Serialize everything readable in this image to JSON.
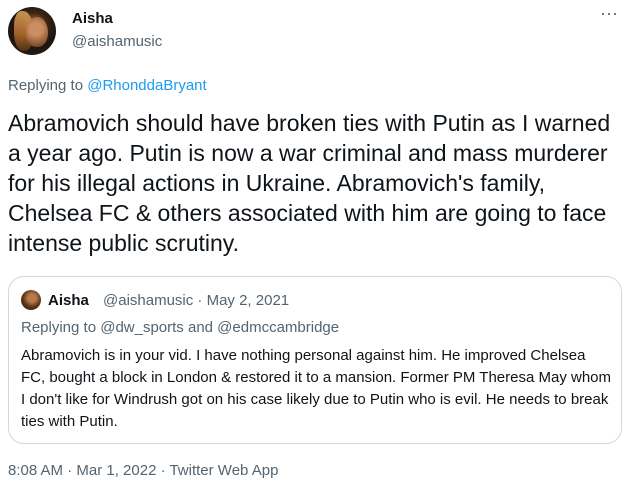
{
  "tweet": {
    "display_name": "Aisha",
    "handle": "@aishamusic",
    "more_icon": "···",
    "replying_prefix": "Replying to",
    "replying_to": "@RhonddaBryant",
    "text": "Abramovich should have broken ties with Putin as I warned a year ago. Putin is now a war criminal and mass murderer for his illegal actions in Ukraine. Abramovich's family, Chelsea FC & others associated with him are going to face intense public scrutiny.",
    "footer": "8:08 AM · Mar 1, 2022 · Twitter Web App"
  },
  "quoted_tweet": {
    "display_name": "Aisha",
    "meta": "@aishamusic · May 2, 2021",
    "replying_line": "Replying to @dw_sports and @edmccambridge",
    "text": "Abramovich is in your vid. I have nothing personal against him. He improved Chelsea FC, bought a block in London & restored it to a mansion. Former PM Theresa May whom I don't like for Windrush got on his case likely due to Putin who is evil. He needs to break ties with Putin."
  },
  "colors": {
    "link": "#1d9bf0",
    "secondary_text": "#536471",
    "primary_text": "#0f1419",
    "border": "#cfd9de"
  }
}
